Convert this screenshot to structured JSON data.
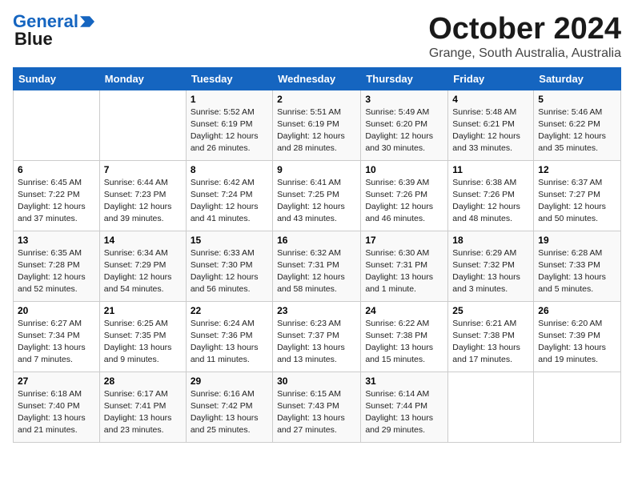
{
  "logo": {
    "line1": "General",
    "line2": "Blue",
    "arrow": "▶"
  },
  "title": "October 2024",
  "location": "Grange, South Australia, Australia",
  "days_of_week": [
    "Sunday",
    "Monday",
    "Tuesday",
    "Wednesday",
    "Thursday",
    "Friday",
    "Saturday"
  ],
  "weeks": [
    [
      {
        "day": "",
        "info": ""
      },
      {
        "day": "",
        "info": ""
      },
      {
        "day": "1",
        "info": "Sunrise: 5:52 AM\nSunset: 6:19 PM\nDaylight: 12 hours\nand 26 minutes."
      },
      {
        "day": "2",
        "info": "Sunrise: 5:51 AM\nSunset: 6:19 PM\nDaylight: 12 hours\nand 28 minutes."
      },
      {
        "day": "3",
        "info": "Sunrise: 5:49 AM\nSunset: 6:20 PM\nDaylight: 12 hours\nand 30 minutes."
      },
      {
        "day": "4",
        "info": "Sunrise: 5:48 AM\nSunset: 6:21 PM\nDaylight: 12 hours\nand 33 minutes."
      },
      {
        "day": "5",
        "info": "Sunrise: 5:46 AM\nSunset: 6:22 PM\nDaylight: 12 hours\nand 35 minutes."
      }
    ],
    [
      {
        "day": "6",
        "info": "Sunrise: 6:45 AM\nSunset: 7:22 PM\nDaylight: 12 hours\nand 37 minutes."
      },
      {
        "day": "7",
        "info": "Sunrise: 6:44 AM\nSunset: 7:23 PM\nDaylight: 12 hours\nand 39 minutes."
      },
      {
        "day": "8",
        "info": "Sunrise: 6:42 AM\nSunset: 7:24 PM\nDaylight: 12 hours\nand 41 minutes."
      },
      {
        "day": "9",
        "info": "Sunrise: 6:41 AM\nSunset: 7:25 PM\nDaylight: 12 hours\nand 43 minutes."
      },
      {
        "day": "10",
        "info": "Sunrise: 6:39 AM\nSunset: 7:26 PM\nDaylight: 12 hours\nand 46 minutes."
      },
      {
        "day": "11",
        "info": "Sunrise: 6:38 AM\nSunset: 7:26 PM\nDaylight: 12 hours\nand 48 minutes."
      },
      {
        "day": "12",
        "info": "Sunrise: 6:37 AM\nSunset: 7:27 PM\nDaylight: 12 hours\nand 50 minutes."
      }
    ],
    [
      {
        "day": "13",
        "info": "Sunrise: 6:35 AM\nSunset: 7:28 PM\nDaylight: 12 hours\nand 52 minutes."
      },
      {
        "day": "14",
        "info": "Sunrise: 6:34 AM\nSunset: 7:29 PM\nDaylight: 12 hours\nand 54 minutes."
      },
      {
        "day": "15",
        "info": "Sunrise: 6:33 AM\nSunset: 7:30 PM\nDaylight: 12 hours\nand 56 minutes."
      },
      {
        "day": "16",
        "info": "Sunrise: 6:32 AM\nSunset: 7:31 PM\nDaylight: 12 hours\nand 58 minutes."
      },
      {
        "day": "17",
        "info": "Sunrise: 6:30 AM\nSunset: 7:31 PM\nDaylight: 13 hours\nand 1 minute."
      },
      {
        "day": "18",
        "info": "Sunrise: 6:29 AM\nSunset: 7:32 PM\nDaylight: 13 hours\nand 3 minutes."
      },
      {
        "day": "19",
        "info": "Sunrise: 6:28 AM\nSunset: 7:33 PM\nDaylight: 13 hours\nand 5 minutes."
      }
    ],
    [
      {
        "day": "20",
        "info": "Sunrise: 6:27 AM\nSunset: 7:34 PM\nDaylight: 13 hours\nand 7 minutes."
      },
      {
        "day": "21",
        "info": "Sunrise: 6:25 AM\nSunset: 7:35 PM\nDaylight: 13 hours\nand 9 minutes."
      },
      {
        "day": "22",
        "info": "Sunrise: 6:24 AM\nSunset: 7:36 PM\nDaylight: 13 hours\nand 11 minutes."
      },
      {
        "day": "23",
        "info": "Sunrise: 6:23 AM\nSunset: 7:37 PM\nDaylight: 13 hours\nand 13 minutes."
      },
      {
        "day": "24",
        "info": "Sunrise: 6:22 AM\nSunset: 7:38 PM\nDaylight: 13 hours\nand 15 minutes."
      },
      {
        "day": "25",
        "info": "Sunrise: 6:21 AM\nSunset: 7:38 PM\nDaylight: 13 hours\nand 17 minutes."
      },
      {
        "day": "26",
        "info": "Sunrise: 6:20 AM\nSunset: 7:39 PM\nDaylight: 13 hours\nand 19 minutes."
      }
    ],
    [
      {
        "day": "27",
        "info": "Sunrise: 6:18 AM\nSunset: 7:40 PM\nDaylight: 13 hours\nand 21 minutes."
      },
      {
        "day": "28",
        "info": "Sunrise: 6:17 AM\nSunset: 7:41 PM\nDaylight: 13 hours\nand 23 minutes."
      },
      {
        "day": "29",
        "info": "Sunrise: 6:16 AM\nSunset: 7:42 PM\nDaylight: 13 hours\nand 25 minutes."
      },
      {
        "day": "30",
        "info": "Sunrise: 6:15 AM\nSunset: 7:43 PM\nDaylight: 13 hours\nand 27 minutes."
      },
      {
        "day": "31",
        "info": "Sunrise: 6:14 AM\nSunset: 7:44 PM\nDaylight: 13 hours\nand 29 minutes."
      },
      {
        "day": "",
        "info": ""
      },
      {
        "day": "",
        "info": ""
      }
    ]
  ]
}
